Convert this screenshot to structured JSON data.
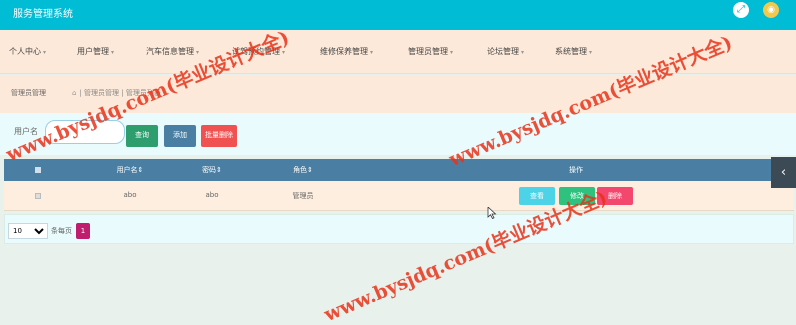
{
  "app": {
    "title": "服务管理系统",
    "fullscreen_icon": "expand-icon",
    "avatar_icon": "user-avatar-icon"
  },
  "nav": {
    "items": [
      {
        "label": "个人中心"
      },
      {
        "label": "用户管理"
      },
      {
        "label": "汽车信息管理"
      },
      {
        "label": "试驾预约管理"
      },
      {
        "label": "维修保养管理"
      },
      {
        "label": "管理员管理"
      },
      {
        "label": "论坛管理"
      },
      {
        "label": "系统管理"
      }
    ]
  },
  "breadcrumb": {
    "title": "管理员管理",
    "path": "| 管理员管理 | 管理员列表"
  },
  "search": {
    "label": "用户名",
    "value": "",
    "placeholder": "",
    "search_button": "查询",
    "add_button": "添加",
    "batch_delete_button": "批量删除"
  },
  "table": {
    "headers": {
      "username": "用户名⇕",
      "password": "密码⇕",
      "role": "角色⇕",
      "actions": "操作"
    },
    "rows": [
      {
        "username": "abo",
        "password": "abo",
        "role": "管理员",
        "view": "查看",
        "edit": "修改",
        "delete": "删除"
      }
    ]
  },
  "pagination": {
    "page_size": "10",
    "page_size_options": [
      "10"
    ],
    "per_page_label": "条每页",
    "current_page": "1"
  },
  "watermark": {
    "text": "www.bysjdq.com(毕业设计大全)",
    "color": "#e8331a"
  },
  "colors": {
    "topbar": "#00bcd4",
    "nav_bg": "#fde9d9",
    "table_header": "#4a7fa3",
    "danger": "#f05252"
  }
}
